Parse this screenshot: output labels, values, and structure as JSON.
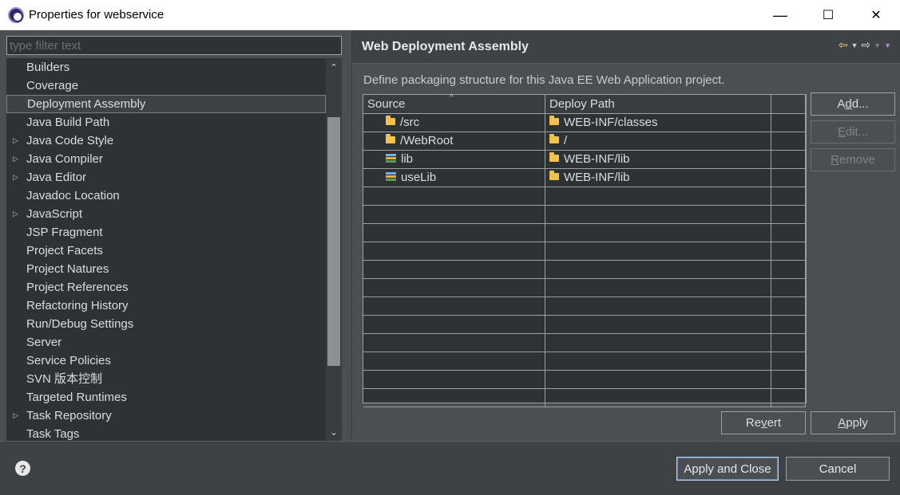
{
  "window": {
    "title": "Properties for webservice",
    "minimize": "—",
    "maximize": "☐",
    "close": "✕"
  },
  "filter": {
    "placeholder": "type filter text"
  },
  "tree": {
    "items": [
      {
        "label": "Builders",
        "expandable": false
      },
      {
        "label": "Coverage",
        "expandable": false
      },
      {
        "label": "Deployment Assembly",
        "expandable": false,
        "selected": true
      },
      {
        "label": "Java Build Path",
        "expandable": false
      },
      {
        "label": "Java Code Style",
        "expandable": true
      },
      {
        "label": "Java Compiler",
        "expandable": true
      },
      {
        "label": "Java Editor",
        "expandable": true
      },
      {
        "label": "Javadoc Location",
        "expandable": false
      },
      {
        "label": "JavaScript",
        "expandable": true
      },
      {
        "label": "JSP Fragment",
        "expandable": false
      },
      {
        "label": "Project Facets",
        "expandable": false
      },
      {
        "label": "Project Natures",
        "expandable": false
      },
      {
        "label": "Project References",
        "expandable": false
      },
      {
        "label": "Refactoring History",
        "expandable": false
      },
      {
        "label": "Run/Debug Settings",
        "expandable": false
      },
      {
        "label": "Server",
        "expandable": false
      },
      {
        "label": "Service Policies",
        "expandable": false
      },
      {
        "label": "SVN 版本控制",
        "expandable": false
      },
      {
        "label": "Targeted Runtimes",
        "expandable": false
      },
      {
        "label": "Task Repository",
        "expandable": true
      },
      {
        "label": "Task Tags",
        "expandable": false
      }
    ]
  },
  "panel": {
    "title": "Web Deployment Assembly",
    "description": "Define packaging structure for this Java EE Web Application project."
  },
  "table": {
    "columns": [
      "Source",
      "Deploy Path",
      ""
    ],
    "rows": [
      {
        "source": "/src",
        "source_icon": "folder-icon",
        "deploy": "WEB-INF/classes"
      },
      {
        "source": "/WebRoot",
        "source_icon": "folder-icon",
        "deploy": "/"
      },
      {
        "source": "lib",
        "source_icon": "library-icon",
        "deploy": "WEB-INF/lib"
      },
      {
        "source": "useLib",
        "source_icon": "library-icon",
        "deploy": "WEB-INF/lib"
      }
    ],
    "empty_rows": 12
  },
  "buttons": {
    "add": "Add...",
    "edit": "Edit...",
    "remove": "Remove",
    "revert": "Revert",
    "apply": "Apply",
    "apply_and_close": "Apply and Close",
    "cancel": "Cancel"
  },
  "colors": {
    "accent_folder": "#f2c14e",
    "nav_arrow": "#f5d36a"
  }
}
